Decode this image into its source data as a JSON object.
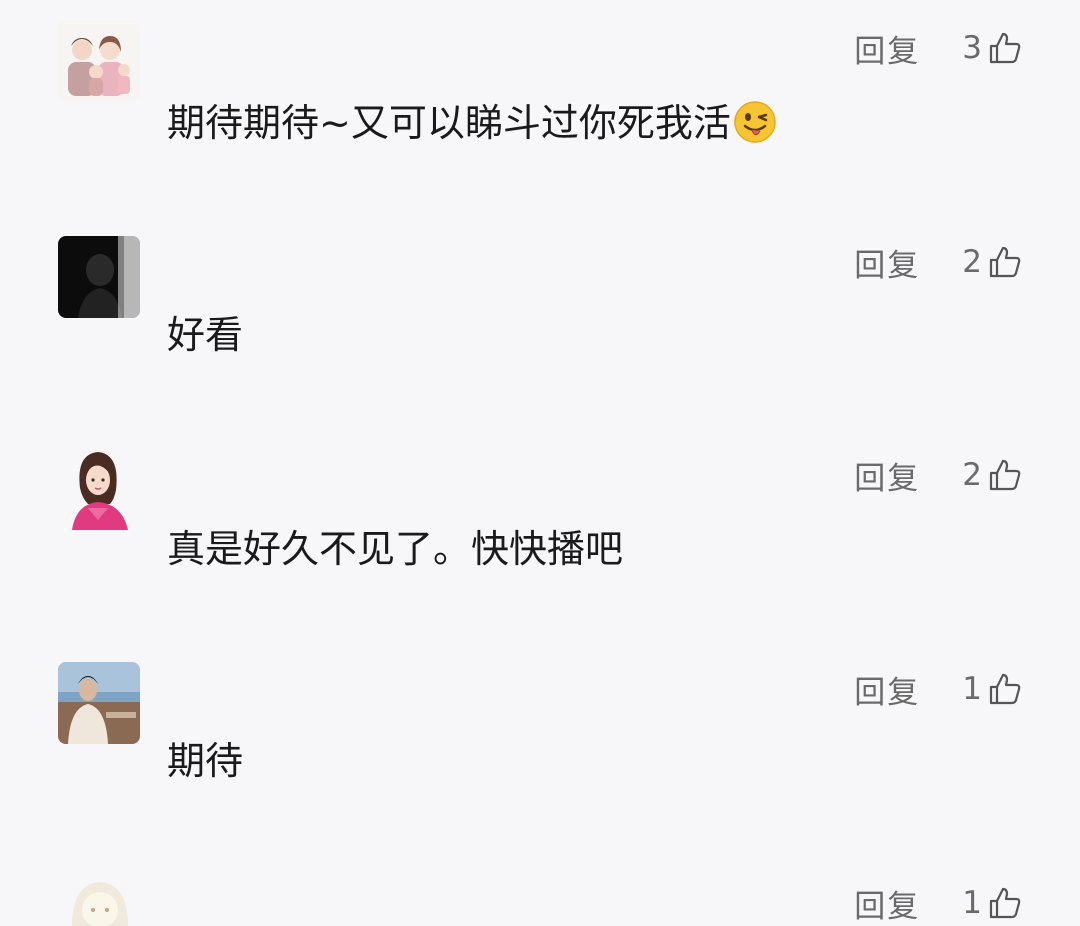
{
  "comments": [
    {
      "reply_label": "回复",
      "likes": "3",
      "text": "期待期待~又可以睇斗过你死我活",
      "emoji": "winking-tongue-emoji"
    },
    {
      "reply_label": "回复",
      "likes": "2",
      "text": "好看"
    },
    {
      "reply_label": "回复",
      "likes": "2",
      "text": "真是好久不见了。快快播吧"
    },
    {
      "reply_label": "回复",
      "likes": "1",
      "text": "期待"
    },
    {
      "reply_label": "回复",
      "likes": "1"
    }
  ],
  "icons": {
    "like": "thumbs-up-outline-icon"
  },
  "colors": {
    "background": "#f7f7f9",
    "text": "#1a1a1a",
    "meta": "#6a6a6a"
  }
}
